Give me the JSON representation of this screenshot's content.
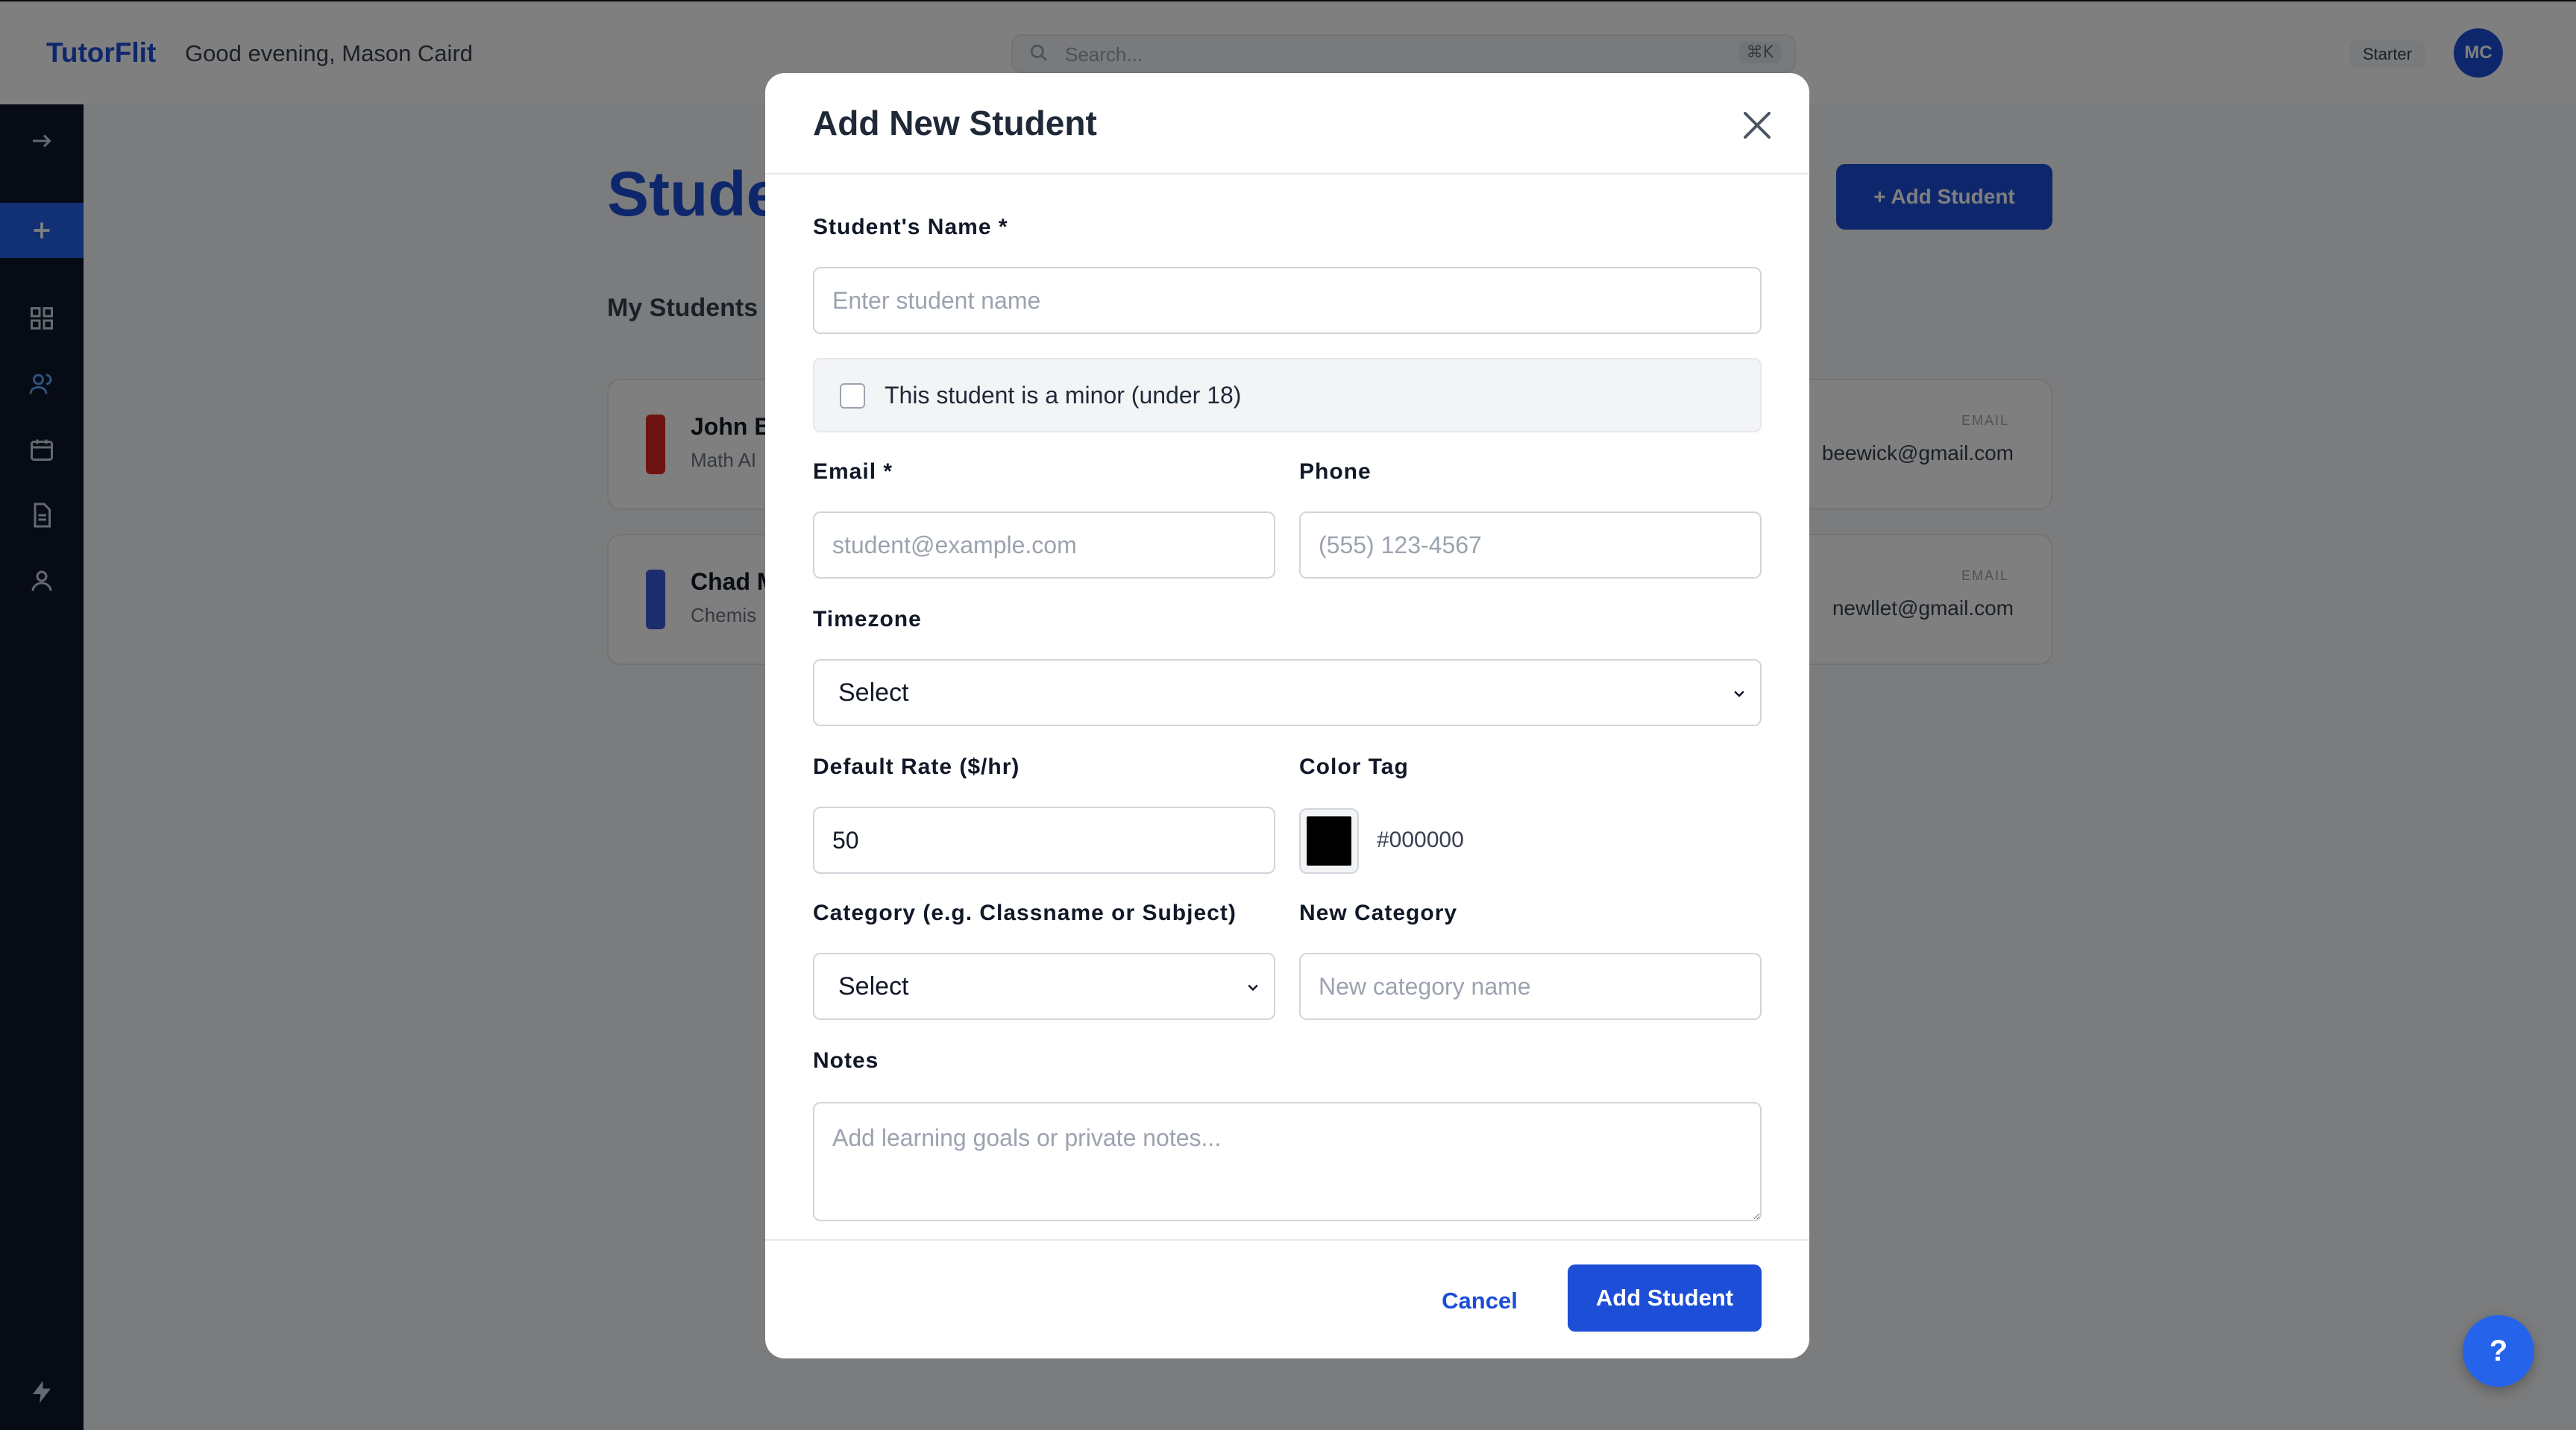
{
  "header": {
    "brand": "TutorFlit",
    "greeting": "Good evening, Mason Caird",
    "search_placeholder": "Search...",
    "search_shortcut": "⌘K",
    "plan_badge": "Starter",
    "avatar_initials": "MC"
  },
  "sidebar": {
    "items": [
      {
        "icon": "collapse-arrow-icon"
      },
      {
        "icon": "plus-icon"
      },
      {
        "icon": "dashboard-grid-icon"
      },
      {
        "icon": "students-icon"
      },
      {
        "icon": "calendar-icon"
      },
      {
        "icon": "document-icon"
      },
      {
        "icon": "user-icon"
      },
      {
        "icon": "bolt-icon"
      }
    ]
  },
  "page": {
    "title": "Students",
    "add_button": "+ Add Student",
    "section_title": "My Students",
    "students": [
      {
        "name": "John B",
        "subtitle": "Math AI",
        "email_label": "EMAIL",
        "email": "beewick@gmail.com",
        "color": "#dc2626"
      },
      {
        "name": "Chad M",
        "subtitle": "Chemis",
        "email_label": "EMAIL",
        "email": "newllet@gmail.com",
        "color": "#3b5bdb"
      }
    ]
  },
  "modal": {
    "title": "Add New Student",
    "fields": {
      "name_label": "Student's Name *",
      "name_placeholder": "Enter student name",
      "minor_label": "This student is a minor (under 18)",
      "email_label": "Email *",
      "email_placeholder": "student@example.com",
      "phone_label": "Phone",
      "phone_placeholder": "(555) 123-4567",
      "timezone_label": "Timezone",
      "timezone_value": "Select",
      "rate_label": "Default Rate ($/hr)",
      "rate_value": "50",
      "color_label": "Color Tag",
      "color_value": "#000000",
      "category_label": "Category (e.g. Classname or Subject)",
      "category_value": "Select",
      "new_category_label": "New Category",
      "new_category_placeholder": "New category name",
      "notes_label": "Notes",
      "notes_placeholder": "Add learning goals or private notes..."
    },
    "cancel_label": "Cancel",
    "submit_label": "Add Student"
  },
  "help_label": "?"
}
